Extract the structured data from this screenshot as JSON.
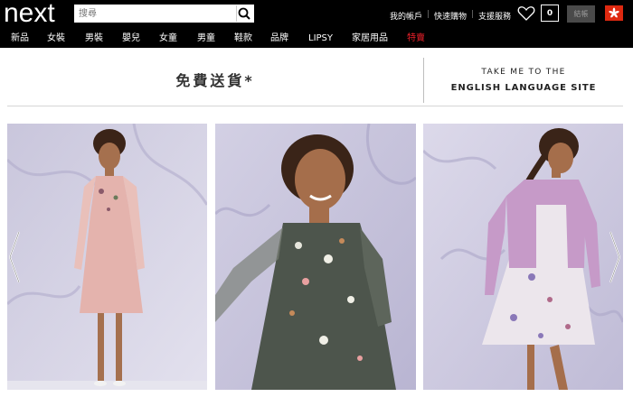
{
  "header": {
    "logo": "next",
    "search_placeholder": "搜尋",
    "links": [
      "我的帳戶",
      "快速購物",
      "支援服務"
    ],
    "bag_count": "0",
    "checkout_label": "結帳"
  },
  "nav": {
    "items": [
      "新品",
      "女裝",
      "男裝",
      "嬰兒",
      "女童",
      "男童",
      "鞋款",
      "品牌",
      "LIPSY",
      "家居用品",
      "特賣"
    ],
    "sale_color": "#e8202a"
  },
  "promo": {
    "free_delivery": "免費送貨*",
    "english_line1": "TAKE ME TO THE",
    "english_line2": "ENGLISH LANGUAGE SITE"
  },
  "colors": {
    "topbar": "#000000",
    "sale": "#e8202a",
    "flag": "#de2910"
  }
}
